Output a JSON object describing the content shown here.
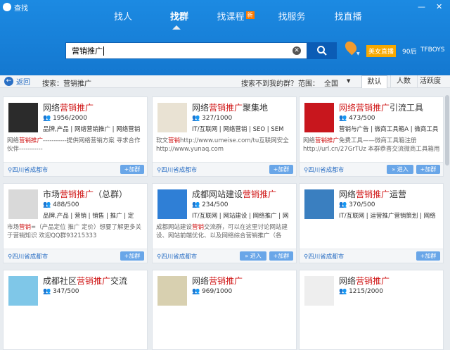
{
  "window": {
    "title": "查找"
  },
  "tabs": [
    {
      "label": "找人"
    },
    {
      "label": "找群"
    },
    {
      "label": "找课程",
      "badge": "新"
    },
    {
      "label": "找服务"
    },
    {
      "label": "找直播"
    }
  ],
  "search": {
    "value": "营销推广"
  },
  "promo": {
    "beauty": "美女直播",
    "after90": "90后",
    "tfboys": "TFBOYS"
  },
  "filter": {
    "back": "返回",
    "breadcrumb": "搜索：营销推广",
    "notfound": "搜索不到我的群？",
    "scope_label": "范围：",
    "scope_value": "全国",
    "sort": [
      "默认",
      "人数",
      "活跃度"
    ]
  },
  "cards": [
    {
      "pre": "网络",
      "kw": "营销推广",
      "post": "",
      "count": "1956/2000",
      "tags": "品牌,产品 | 网络营销推广 | 网络营销",
      "desc1": "网络",
      "desc_kw": "营销推广",
      "desc2": "-----------提供网络营销方案 寻求合作伙伴-----------",
      "loc": "四川省成都市",
      "join": "+加群",
      "enter": "",
      "logo_color": "#2b2b2b"
    },
    {
      "pre": "网络",
      "kw": "营销推广",
      "post": "聚集地",
      "count": "327/1000",
      "tags": "IT/互联网 | 网络营销 | SEO | SEM",
      "desc1": "软文",
      "desc_kw": "营销",
      "desc2": "http://www.umeise.com/tu互联网安全 http://www.yunaq.com",
      "loc": "四川省成都市",
      "join": "+加群",
      "enter": "",
      "logo_color": "#e9e2d3"
    },
    {
      "pre": "",
      "kw": "网络营销推广",
      "post": "引流工具",
      "count": "473/500",
      "tags": "营销与广告 | 微商工具箱A | 微商工具",
      "desc1": "网络",
      "desc_kw": "营销推广",
      "desc2": "免费工具——微商工具箱注册 http://url.cn/27GrTUz 本群恭喜交流微商工具箱用法",
      "loc": "四川省成都市",
      "join": "+加群",
      "enter": "» 进入",
      "logo_color": "#c8161d"
    },
    {
      "pre": "市场",
      "kw": "营销推广",
      "post": "（总群）",
      "count": "488/500",
      "tags": "品牌,产品 | 营销 | 销售 | 推广 | 定",
      "desc1": "市场",
      "desc_kw": "营销",
      "desc2": "=（产品定位 推广 定价）想要了解更多关于营销知识 欢迎QQ群93215333",
      "loc": "四川省成都市",
      "join": "+加群",
      "enter": "",
      "logo_color": "#d9d9d9"
    },
    {
      "pre": "成都网站建设",
      "kw": "营销推广",
      "post": "",
      "count": "234/500",
      "tags": "IT/互联网 | 网站建设 | 网络推广 | 网",
      "desc1": "成都网站建设",
      "desc_kw": "营销",
      "desc2": "交流群，可以在这里讨论网站建设、网站前端优化、以及网络综合营销推广（各",
      "loc": "四川省成都市",
      "join": "+加群",
      "enter": "» 进入",
      "logo_color": "#2f7fd6"
    },
    {
      "pre": "网络",
      "kw": "营销推广",
      "post": "运营",
      "count": "370/500",
      "tags": "IT/互联网 | 运营推广营销策划 | 网络",
      "desc1": "",
      "desc_kw": "",
      "desc2": "",
      "loc": "四川省成都市",
      "join": "+加群",
      "enter": "",
      "logo_color": "#3a7fc0"
    },
    {
      "pre": "成都社区",
      "kw": "营销推广",
      "post": "交流",
      "count": "347/500",
      "tags": "",
      "desc1": "",
      "desc_kw": "",
      "desc2": "",
      "loc": "",
      "join": "",
      "enter": "",
      "logo_color": "#7fc7e8"
    },
    {
      "pre": "网络",
      "kw": "营销推广",
      "post": "",
      "count": "969/1000",
      "tags": "",
      "desc1": "",
      "desc_kw": "",
      "desc2": "",
      "loc": "",
      "join": "",
      "enter": "",
      "logo_color": "#d8d0b0"
    },
    {
      "pre": "网络",
      "kw": "营销推广",
      "post": "",
      "count": "1215/2000",
      "tags": "",
      "desc1": "",
      "desc_kw": "",
      "desc2": "",
      "loc": "",
      "join": "",
      "enter": "",
      "logo_color": "#eeeeee"
    }
  ]
}
